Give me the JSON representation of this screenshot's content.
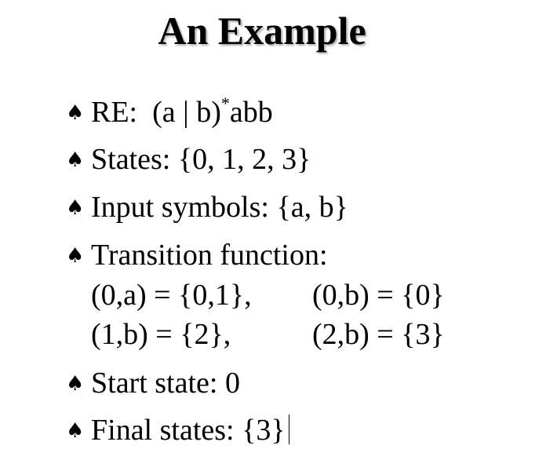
{
  "slide": {
    "title": "An Example",
    "re": {
      "label": "RE:",
      "expr_main": "(a | b)",
      "expr_sup": "*",
      "expr_tail": "abb"
    },
    "states": "States: {0, 1, 2, 3}",
    "input_symbols": "Input symbols: {a, b}",
    "transition_label": "Transition function:",
    "transitions": [
      "(0,a) = {0,1},",
      "(0,b) = {0}",
      "(1,b) = {2},",
      "(2,b) = {3}"
    ],
    "start_state": "Start state: 0",
    "final_states": "Final states: {3}",
    "bullet_glyph": "♠"
  }
}
